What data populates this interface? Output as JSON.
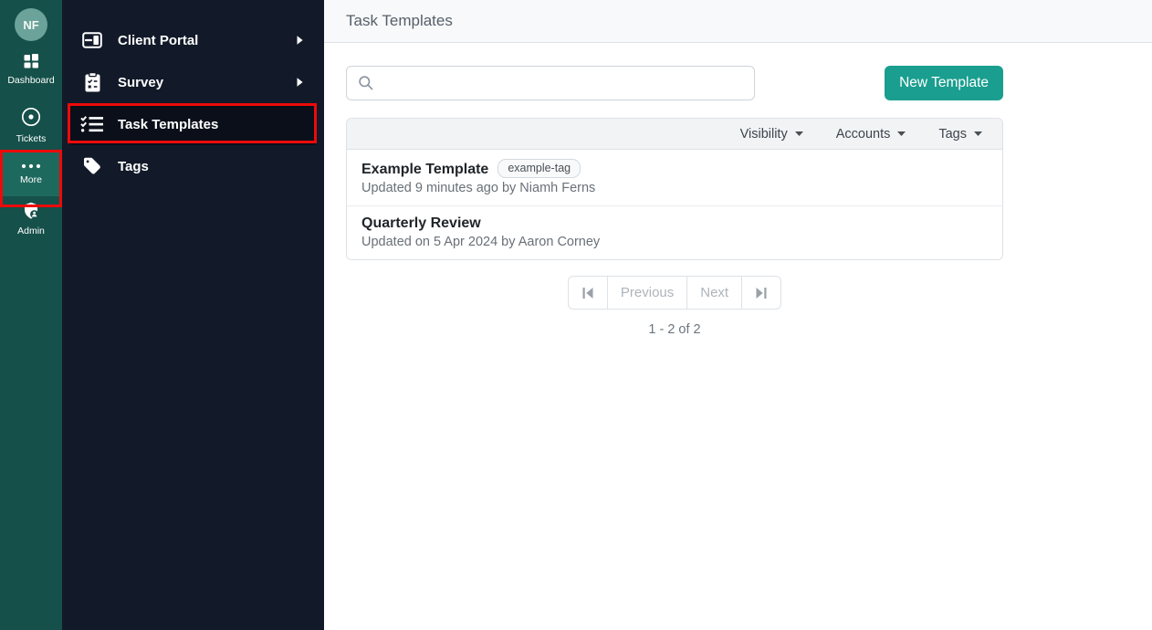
{
  "header": {
    "title": "Task Templates"
  },
  "rail": {
    "avatar_initials": "NF",
    "items": [
      {
        "label": "Dashboard",
        "icon": "dashboard-grid-icon"
      },
      {
        "label": "Tickets",
        "icon": "record-circle-icon"
      },
      {
        "label": "More",
        "icon": "ellipsis-icon",
        "selected": true,
        "annotated": true
      },
      {
        "label": "Admin",
        "icon": "shield-person-icon"
      }
    ]
  },
  "sidebar": {
    "items": [
      {
        "label": "Client Portal",
        "icon": "window-sidebar-icon",
        "has_submenu": true
      },
      {
        "label": "Survey",
        "icon": "clipboard-check-icon",
        "has_submenu": true
      },
      {
        "label": "Task Templates",
        "icon": "list-check-icon",
        "active": true,
        "annotated": true
      },
      {
        "label": "Tags",
        "icon": "tag-icon",
        "has_submenu": false
      }
    ]
  },
  "toolbar": {
    "search_placeholder": "",
    "new_template_label": "New Template"
  },
  "table": {
    "filters": [
      {
        "label": "Visibility"
      },
      {
        "label": "Accounts"
      },
      {
        "label": "Tags"
      }
    ],
    "rows": [
      {
        "title": "Example Template",
        "tag": "example-tag",
        "subtitle": "Updated 9 minutes ago by Niamh Ferns"
      },
      {
        "title": "Quarterly Review",
        "subtitle": "Updated on 5 Apr 2024 by Aaron Corney"
      }
    ]
  },
  "pagination": {
    "previous_label": "Previous",
    "next_label": "Next",
    "summary": "1 - 2 of 2"
  },
  "colors": {
    "accent": "#1a9e8f",
    "rail_bg": "#15504a",
    "rail_selected_bg": "#1e695e",
    "sidebar_bg": "#121a29",
    "sidebar_active_bg": "#0a0f19",
    "annotation": "#ed0a0a",
    "topbar_bg": "#f8f9fa",
    "table_header_bg": "#f1f3f5"
  }
}
